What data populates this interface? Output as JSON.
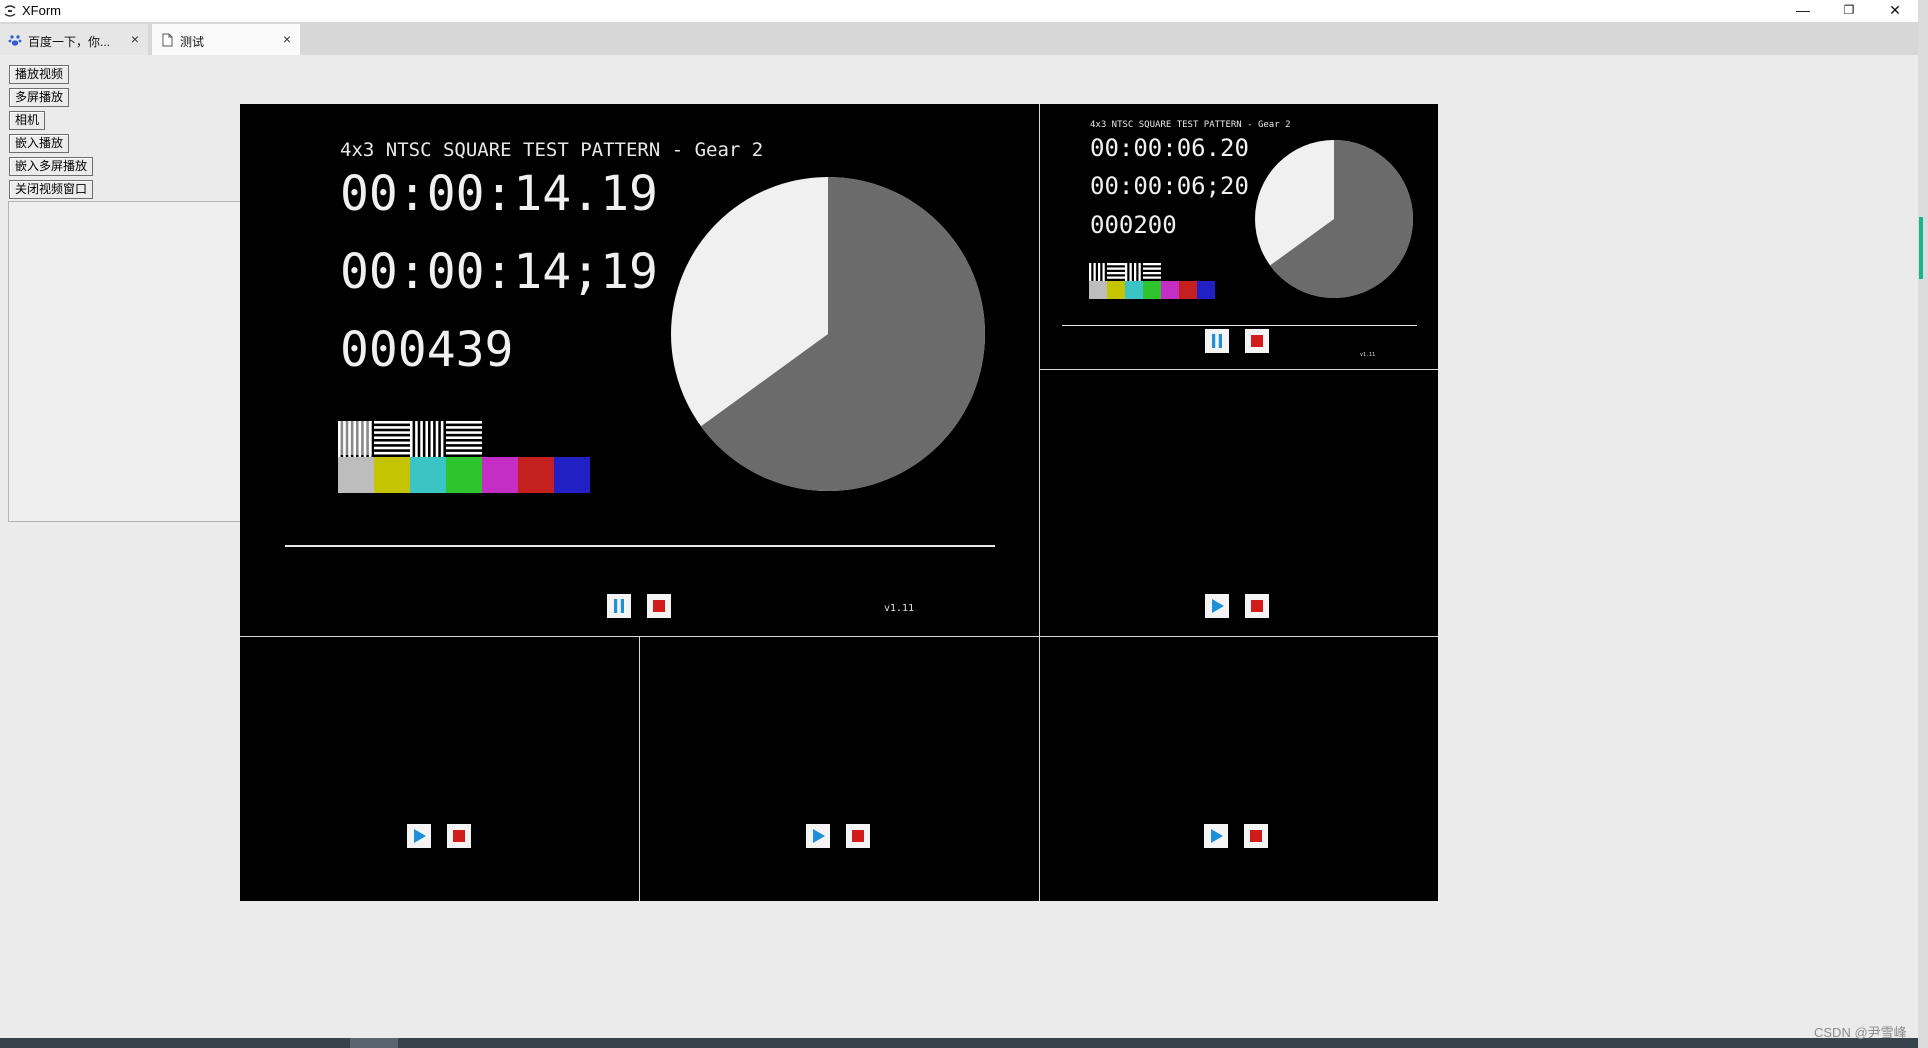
{
  "window": {
    "title": "XForm",
    "minimize_glyph": "—",
    "maximize_glyph": "❐",
    "close_glyph": "✕"
  },
  "tabs": [
    {
      "label": "百度一下，你...",
      "icon": "baidu-paw-icon",
      "close": "×"
    },
    {
      "label": "测试",
      "icon": "document-icon",
      "close": "×"
    }
  ],
  "left_buttons": [
    "播放视频",
    "多屏播放",
    "相机",
    "嵌入播放",
    "嵌入多屏播放",
    "关闭视频窗口"
  ],
  "main_video": {
    "pattern_title": "4x3 NTSC SQUARE TEST PATTERN - Gear 2",
    "timecode_dot": "00:00:14.19",
    "timecode_semicolon": "00:00:14;19",
    "frame": "000439",
    "version": "v1.11",
    "pie_dark_fraction": 0.65,
    "state": "playing"
  },
  "secondary_video": {
    "pattern_title": "4x3 NTSC SQUARE TEST PATTERN - Gear 2",
    "timecode_dot": "00:00:06.20",
    "timecode_semicolon": "00:00:06;20",
    "frame": "000200",
    "version": "v1.11",
    "pie_dark_fraction": 0.65,
    "state": "playing"
  },
  "color_bars": [
    "#bdbdbd",
    "#c4c400",
    "#3bc4c4",
    "#2ec42e",
    "#c42ec4",
    "#c42020",
    "#2020c4"
  ],
  "controls": {
    "accent_play": "#1e8fd8",
    "accent_stop": "#d21c1c"
  },
  "watermark": "CSDN @尹雪峰"
}
